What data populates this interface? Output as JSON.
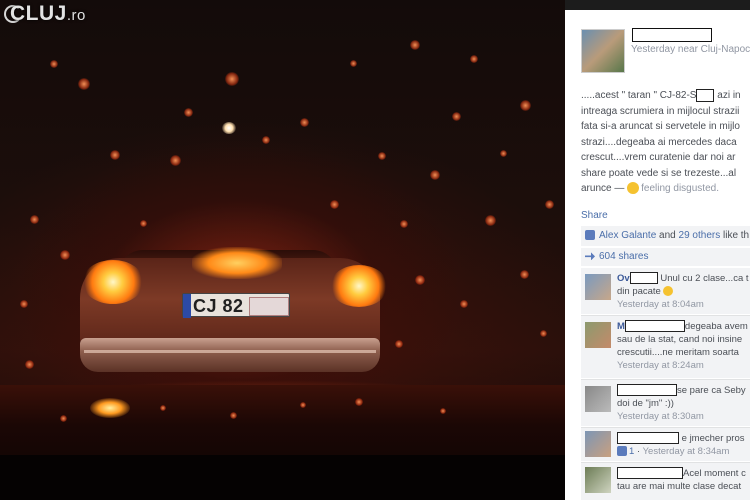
{
  "watermark": {
    "brand": "CLUJ",
    "tld": ".ro"
  },
  "photo": {
    "plate_visible": "CJ 82"
  },
  "post": {
    "timeline": "Yesterday near Cluj-Napoca",
    "lines": [
      ".....acest \" taran \" CJ-82-S",
      "intreaga scrumiera in mijlocul strazii",
      "fata si-a aruncat si servetele in mijlo",
      "strazi....degeaba ai mercedes daca",
      "crescut....vrem curatenie dar noi ar",
      "share poate vede si se trezeste...al"
    ],
    "line1_tail": " azi in",
    "last_line_start": "arunce — ",
    "feeling": "feeling disgusted."
  },
  "actions": {
    "share_label": "Share"
  },
  "likes": {
    "first_name": "Alex Galante",
    "and": " and ",
    "others": "29 others",
    "tail": " like th"
  },
  "shares": {
    "label": "604 shares"
  },
  "comments": [
    {
      "name": "Ov",
      "text": "Unul cu 2 clase...ca t",
      "line2": "din pacate",
      "time": "Yesterday at 8:04am"
    },
    {
      "name": "M",
      "text": "degeaba avem",
      "line2": "sau de la stat, cand noi insine",
      "line3": "crescutii....ne meritam soarta",
      "time": "Yesterday at 8:24am"
    },
    {
      "text": "se pare ca Seby",
      "line2": "doi de \"jm\" :))",
      "time": "Yesterday at 8:30am"
    },
    {
      "text": "e jmecher pros",
      "likes": "1",
      "time": "Yesterday at 8:34am"
    },
    {
      "text": "Acel moment c",
      "line2": "tau are mai multe clase decat"
    }
  ],
  "colors": {
    "fb_link": "#3b5998",
    "fb_bg": "#ffffff",
    "meta_gray": "#9197a3"
  }
}
